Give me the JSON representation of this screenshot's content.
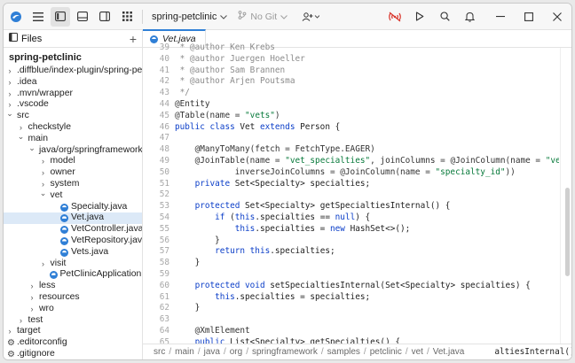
{
  "titlebar": {
    "project": "spring-petclinic",
    "git": "No Git"
  },
  "sidebar": {
    "tab_label": "Files",
    "add_label": "+",
    "root": "spring-petclinic",
    "items": [
      {
        "label": ".diffblue/index-plugin/spring-petclinic",
        "depth": 0,
        "chevron": "right",
        "icon": "none"
      },
      {
        "label": ".idea",
        "depth": 0,
        "chevron": "right",
        "icon": "none"
      },
      {
        "label": ".mvn/wrapper",
        "depth": 0,
        "chevron": "right",
        "icon": "none"
      },
      {
        "label": ".vscode",
        "depth": 0,
        "chevron": "right",
        "icon": "none"
      },
      {
        "label": "src",
        "depth": 0,
        "chevron": "down",
        "icon": "none"
      },
      {
        "label": "checkstyle",
        "depth": 1,
        "chevron": "right",
        "icon": "none"
      },
      {
        "label": "main",
        "depth": 1,
        "chevron": "down",
        "icon": "none"
      },
      {
        "label": "java/org/springframework/samples",
        "depth": 2,
        "chevron": "down",
        "icon": "none"
      },
      {
        "label": "model",
        "depth": 3,
        "chevron": "right",
        "icon": "none"
      },
      {
        "label": "owner",
        "depth": 3,
        "chevron": "right",
        "icon": "none"
      },
      {
        "label": "system",
        "depth": 3,
        "chevron": "right",
        "icon": "none"
      },
      {
        "label": "vet",
        "depth": 3,
        "chevron": "down",
        "icon": "none"
      },
      {
        "label": "Specialty.java",
        "depth": 4,
        "chevron": "none",
        "icon": "java"
      },
      {
        "label": "Vet.java",
        "depth": 4,
        "chevron": "none",
        "icon": "java",
        "selected": true
      },
      {
        "label": "VetController.java",
        "depth": 4,
        "chevron": "none",
        "icon": "java"
      },
      {
        "label": "VetRepository.java",
        "depth": 4,
        "chevron": "none",
        "icon": "java"
      },
      {
        "label": "Vets.java",
        "depth": 4,
        "chevron": "none",
        "icon": "java"
      },
      {
        "label": "visit",
        "depth": 3,
        "chevron": "right",
        "icon": "none"
      },
      {
        "label": "PetClinicApplication.java",
        "depth": 3,
        "chevron": "none",
        "icon": "java"
      },
      {
        "label": "less",
        "depth": 2,
        "chevron": "right",
        "icon": "none"
      },
      {
        "label": "resources",
        "depth": 2,
        "chevron": "right",
        "icon": "none"
      },
      {
        "label": "wro",
        "depth": 2,
        "chevron": "right",
        "icon": "none"
      },
      {
        "label": "test",
        "depth": 1,
        "chevron": "right",
        "icon": "none"
      },
      {
        "label": "target",
        "depth": 0,
        "chevron": "right",
        "icon": "none"
      },
      {
        "label": ".editorconfig",
        "depth": 0,
        "chevron": "none",
        "icon": "gear"
      },
      {
        "label": ".gitignore",
        "depth": 0,
        "chevron": "none",
        "icon": "gear"
      }
    ]
  },
  "editor": {
    "tab_label": "Vet.java",
    "lines": [
      {
        "n": "39",
        "t": [
          [
            "cm",
            " * @author Ken Krebs"
          ]
        ]
      },
      {
        "n": "40",
        "t": [
          [
            "cm",
            " * @author Juergen Hoeller"
          ]
        ]
      },
      {
        "n": "41",
        "t": [
          [
            "cm",
            " * @author Sam Brannen"
          ]
        ]
      },
      {
        "n": "42",
        "t": [
          [
            "cm",
            " * @author Arjen Poutsma"
          ]
        ]
      },
      {
        "n": "43",
        "t": [
          [
            "cm",
            " */"
          ]
        ]
      },
      {
        "n": "44",
        "t": [
          [
            "an",
            "@Entity"
          ]
        ]
      },
      {
        "n": "45",
        "t": [
          [
            "an",
            "@Table(name = "
          ],
          [
            "str",
            "\"vets\""
          ],
          [
            "an",
            ")"
          ]
        ]
      },
      {
        "n": "46",
        "t": [
          [
            "kw",
            "public class "
          ],
          [
            "",
            "Vet "
          ],
          [
            "kw",
            "extends "
          ],
          [
            "",
            "Person {"
          ]
        ]
      },
      {
        "n": "47",
        "t": []
      },
      {
        "n": "48",
        "t": [
          [
            "an",
            "    @ManyToMany(fetch = FetchType.EAGER)"
          ]
        ]
      },
      {
        "n": "49",
        "t": [
          [
            "an",
            "    @JoinTable(name = "
          ],
          [
            "str",
            "\"vet_specialties\""
          ],
          [
            "an",
            ", joinColumns = @JoinColumn(name = "
          ],
          [
            "str",
            "\"vet_id\""
          ],
          [
            "an",
            "),"
          ]
        ]
      },
      {
        "n": "50",
        "t": [
          [
            "an",
            "            inverseJoinColumns = @JoinColumn(name = "
          ],
          [
            "str",
            "\"specialty_id\""
          ],
          [
            "an",
            "))"
          ]
        ]
      },
      {
        "n": "51",
        "t": [
          [
            "kw",
            "    private "
          ],
          [
            "",
            "Set<Specialty> specialties;"
          ]
        ]
      },
      {
        "n": "52",
        "t": []
      },
      {
        "n": "53",
        "t": [
          [
            "kw",
            "    protected "
          ],
          [
            "",
            "Set<Specialty> getSpecialtiesInternal() {"
          ]
        ]
      },
      {
        "n": "54",
        "t": [
          [
            "kw",
            "        if "
          ],
          [
            "",
            "("
          ],
          [
            "kw",
            "this"
          ],
          [
            "",
            ".specialties == "
          ],
          [
            "kw",
            "null"
          ],
          [
            "",
            ") {"
          ]
        ]
      },
      {
        "n": "55",
        "t": [
          [
            "kw",
            "            this"
          ],
          [
            "",
            ".specialties = "
          ],
          [
            "kw",
            "new "
          ],
          [
            "",
            "HashSet<>();"
          ]
        ]
      },
      {
        "n": "56",
        "t": [
          [
            "",
            "        }"
          ]
        ]
      },
      {
        "n": "57",
        "t": [
          [
            "kw",
            "        return this"
          ],
          [
            "",
            ".specialties;"
          ]
        ]
      },
      {
        "n": "58",
        "t": [
          [
            "",
            "    }"
          ]
        ]
      },
      {
        "n": "59",
        "t": []
      },
      {
        "n": "60",
        "t": [
          [
            "kw",
            "    protected void "
          ],
          [
            "",
            "setSpecialtiesInternal(Set<Specialty> specialties) {"
          ]
        ]
      },
      {
        "n": "61",
        "t": [
          [
            "kw",
            "        this"
          ],
          [
            "",
            ".specialties = specialties;"
          ]
        ]
      },
      {
        "n": "62",
        "t": [
          [
            "",
            "    }"
          ]
        ]
      },
      {
        "n": "63",
        "t": []
      },
      {
        "n": "64",
        "t": [
          [
            "an",
            "    @XmlElement"
          ]
        ]
      },
      {
        "n": "65",
        "t": [
          [
            "kw",
            "    public "
          ],
          [
            "",
            "List<Specialty> getSpecialties() {"
          ]
        ]
      }
    ]
  },
  "breadcrumb": {
    "segments": [
      "src",
      "main",
      "java",
      "org",
      "springframework",
      "samples",
      "petclinic",
      "vet",
      "Vet.java"
    ],
    "tail": "altiesInternal());"
  },
  "colors": {
    "accent": "#2f7fd6",
    "record_red": "#d9342b",
    "selected_row": "#dce9f7"
  }
}
